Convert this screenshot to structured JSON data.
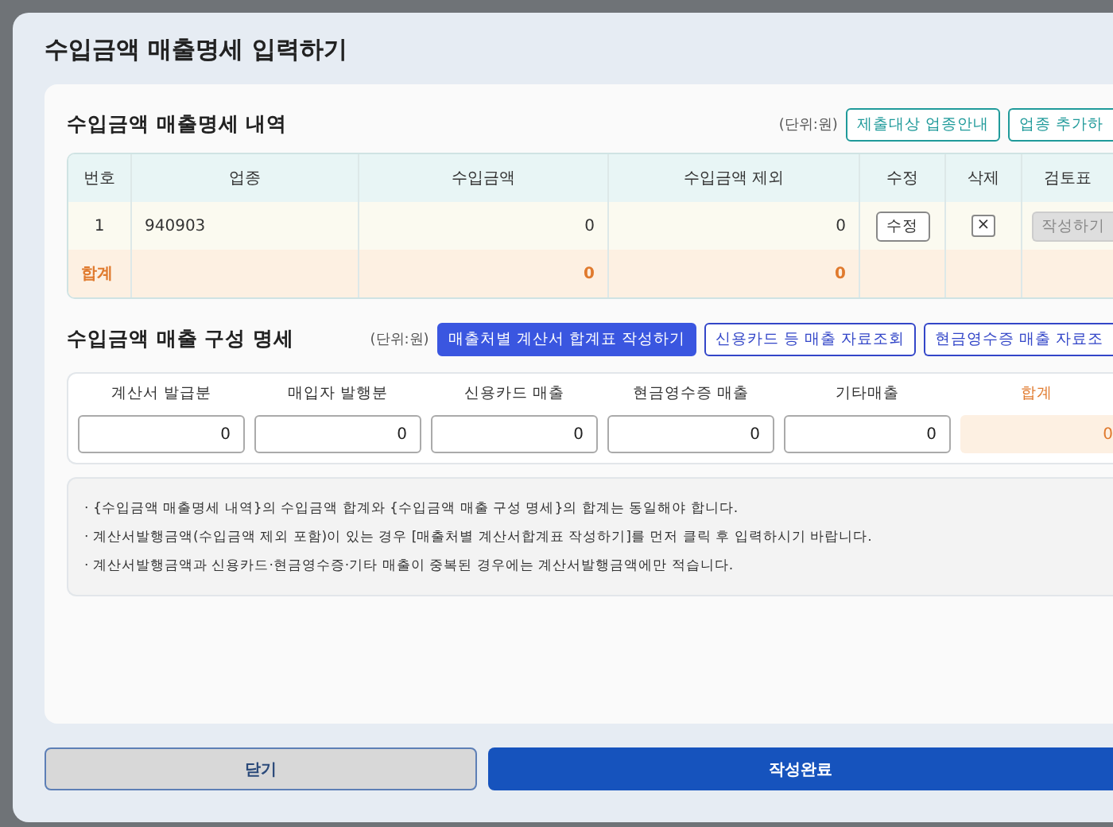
{
  "dialog": {
    "title": "수입금액 매출명세 입력하기"
  },
  "detail_section": {
    "title": "수입금액 매출명세 내역",
    "unit": "(단위:원)",
    "buttons": [
      "제출대상 업종안내",
      "업종 추가하"
    ],
    "table": {
      "columns": [
        "번호",
        "업종",
        "수입금액",
        "수입금액 제외",
        "수정",
        "삭제",
        "검토표"
      ],
      "rows": [
        {
          "no": "1",
          "industry": "940903",
          "income": "0",
          "excluded": "0",
          "edit": "수정",
          "delete": "×",
          "review": {
            "label": "작성하기",
            "disabled": true
          }
        }
      ],
      "total": {
        "label": "합계",
        "income": "0",
        "excluded": "0"
      }
    }
  },
  "composition_section": {
    "title": "수입금액 매출 구성 명세",
    "unit": "(단위:원)",
    "buttons": [
      {
        "label": "매출처별 계산서 합계표 작성하기",
        "primary": true
      },
      {
        "label": "신용카드 등 매출 자료조회",
        "primary": false
      },
      {
        "label": "현금영수증 매출 자료조",
        "primary": false
      }
    ],
    "fields": [
      {
        "label": "계산서 발급분",
        "value": "0",
        "kind": "input"
      },
      {
        "label": "매입자 발행분",
        "value": "0",
        "kind": "input"
      },
      {
        "label": "신용카드 매출",
        "value": "0",
        "kind": "input"
      },
      {
        "label": "현금영수증 매출",
        "value": "0",
        "kind": "input"
      },
      {
        "label": "기타매출",
        "value": "0",
        "kind": "input"
      },
      {
        "label": "합계",
        "value": "0",
        "kind": "total"
      }
    ]
  },
  "notes": [
    "· {수입금액 매출명세 내역}의 수입금액 합계와 {수입금액 매출 구성 명세}의 합계는 동일해야 합니다.",
    "· 계산서발행금액(수입금액 제외 포함)이 있는 경우 [매출처별 계산서합계표 작성하기]를 먼저 클릭 후 입력하시기 바랍니다.",
    "· 계산서발행금액과 신용카드·현금영수증·기타 매출이 중복된 경우에는 계산서발행금액에만 적습니다."
  ],
  "footer_buttons": [
    {
      "label": "닫기",
      "primary": false
    },
    {
      "label": "작성완료",
      "primary": true
    }
  ]
}
